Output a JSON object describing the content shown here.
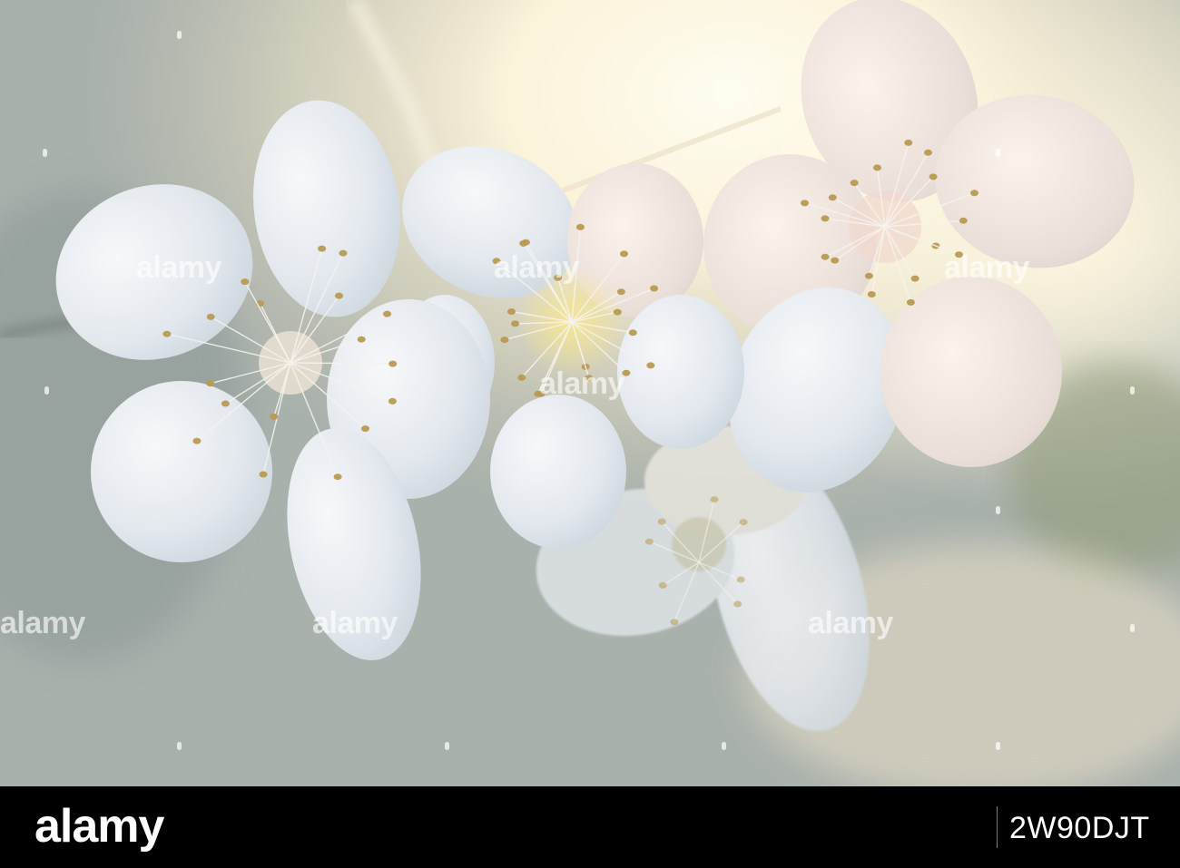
{
  "photo": {
    "subject": "backlit white blossom flowers",
    "palette": {
      "background": "#a8b1ab",
      "sunlight": "#fffbe8",
      "petal": "#eef2f4",
      "petal_shadow": "#c9d3da",
      "stamen": "#b89a52",
      "center": "#f4e08a"
    }
  },
  "watermark": {
    "text": "alamy"
  },
  "footer": {
    "logo": "alamy",
    "image_id": "2W90DJT"
  }
}
